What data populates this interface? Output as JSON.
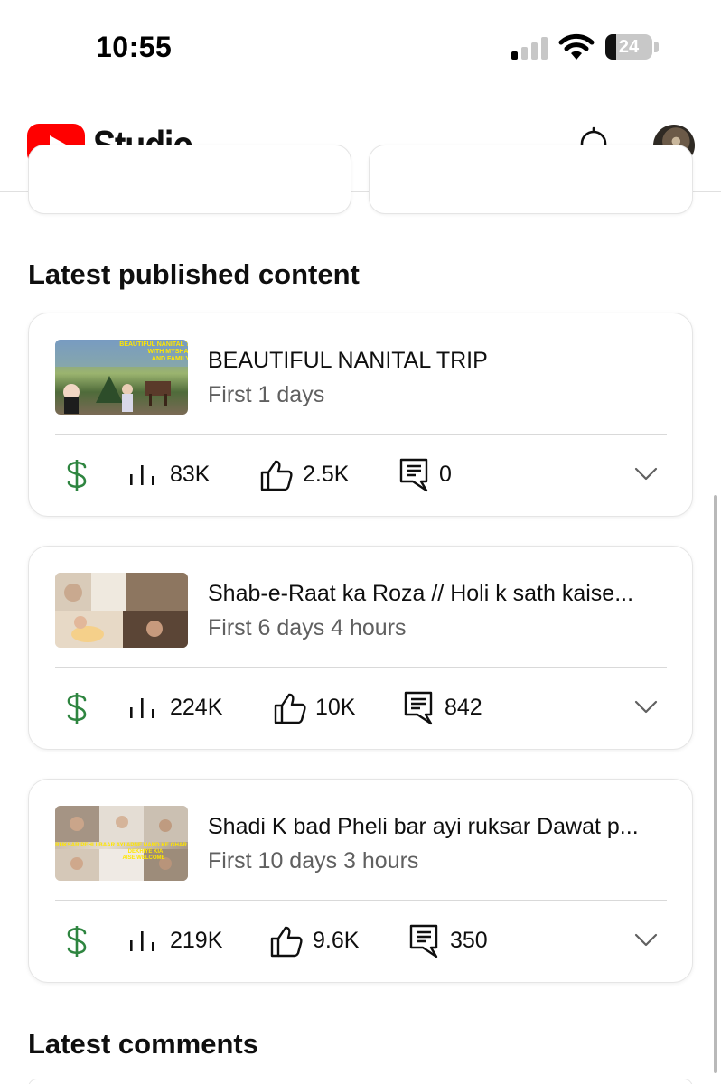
{
  "status_bar": {
    "time": "10:55",
    "battery_level": 24,
    "battery_text": "24",
    "signal_bars_active": 1
  },
  "header": {
    "app_name": "Studio",
    "brand_color": "#ff0000",
    "notifications_icon": "bell-icon",
    "avatar_icon": "account-avatar"
  },
  "latest_content": {
    "heading": "Latest published content",
    "items": [
      {
        "title": "BEAUTIFUL NANITAL TRIP",
        "age": "First 1 days",
        "thumbnail_text": "BEAUTIFUL NANITAL TRIP WITH MYSHA AND FAMILY",
        "views": "83K",
        "likes": "2.5K",
        "comments": "0"
      },
      {
        "title": "Shab-e-Raat  ka Roza // Holi k sath kaise...",
        "age": "First 6 days 4 hours",
        "thumbnail_text": "",
        "views": "224K",
        "likes": "10K",
        "comments": "842"
      },
      {
        "title": "Shadi K bad Pheli bar ayi ruksar Dawat p...",
        "age": "First 10 days 3 hours",
        "thumbnail_text": "RUKSAR PEHLI BAAR AYI APNE NAND KE GHAR DEKHIYE KIA AISE WELCOME",
        "views": "219K",
        "likes": "9.6K",
        "comments": "350"
      }
    ],
    "icons": {
      "monetization": "dollar-icon",
      "views": "analytics-bars-icon",
      "likes": "thumbs-up-icon",
      "comments": "comment-icon",
      "expand": "chevron-down-icon"
    },
    "monetization_color": "#2e8540"
  },
  "latest_comments": {
    "heading": "Latest comments"
  }
}
